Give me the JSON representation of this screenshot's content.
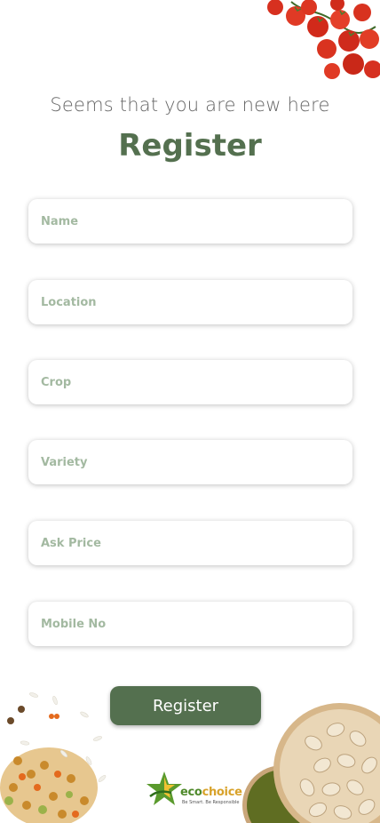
{
  "header": {
    "subtitle": "Seems that you are new here",
    "title": "Register"
  },
  "form": {
    "name_placeholder": "Name",
    "location_placeholder": "Location",
    "crop_placeholder": "Crop",
    "variety_placeholder": "Variety",
    "ask_price_placeholder": "Ask Price",
    "mobile_placeholder": "Mobile No",
    "submit_label": "Register"
  },
  "brand": {
    "name_part1": "eco",
    "name_part2": "choice",
    "tagline": "Be Smart. Be Responsible"
  },
  "colors": {
    "accent": "#54704f",
    "placeholder": "#a3b9a1",
    "subtitle": "#666666"
  },
  "icons": {
    "tomatoes": "tomatoes-image",
    "grains": "grains-image",
    "nuts": "pistachio-image",
    "logo": "ecochoice-logo"
  }
}
